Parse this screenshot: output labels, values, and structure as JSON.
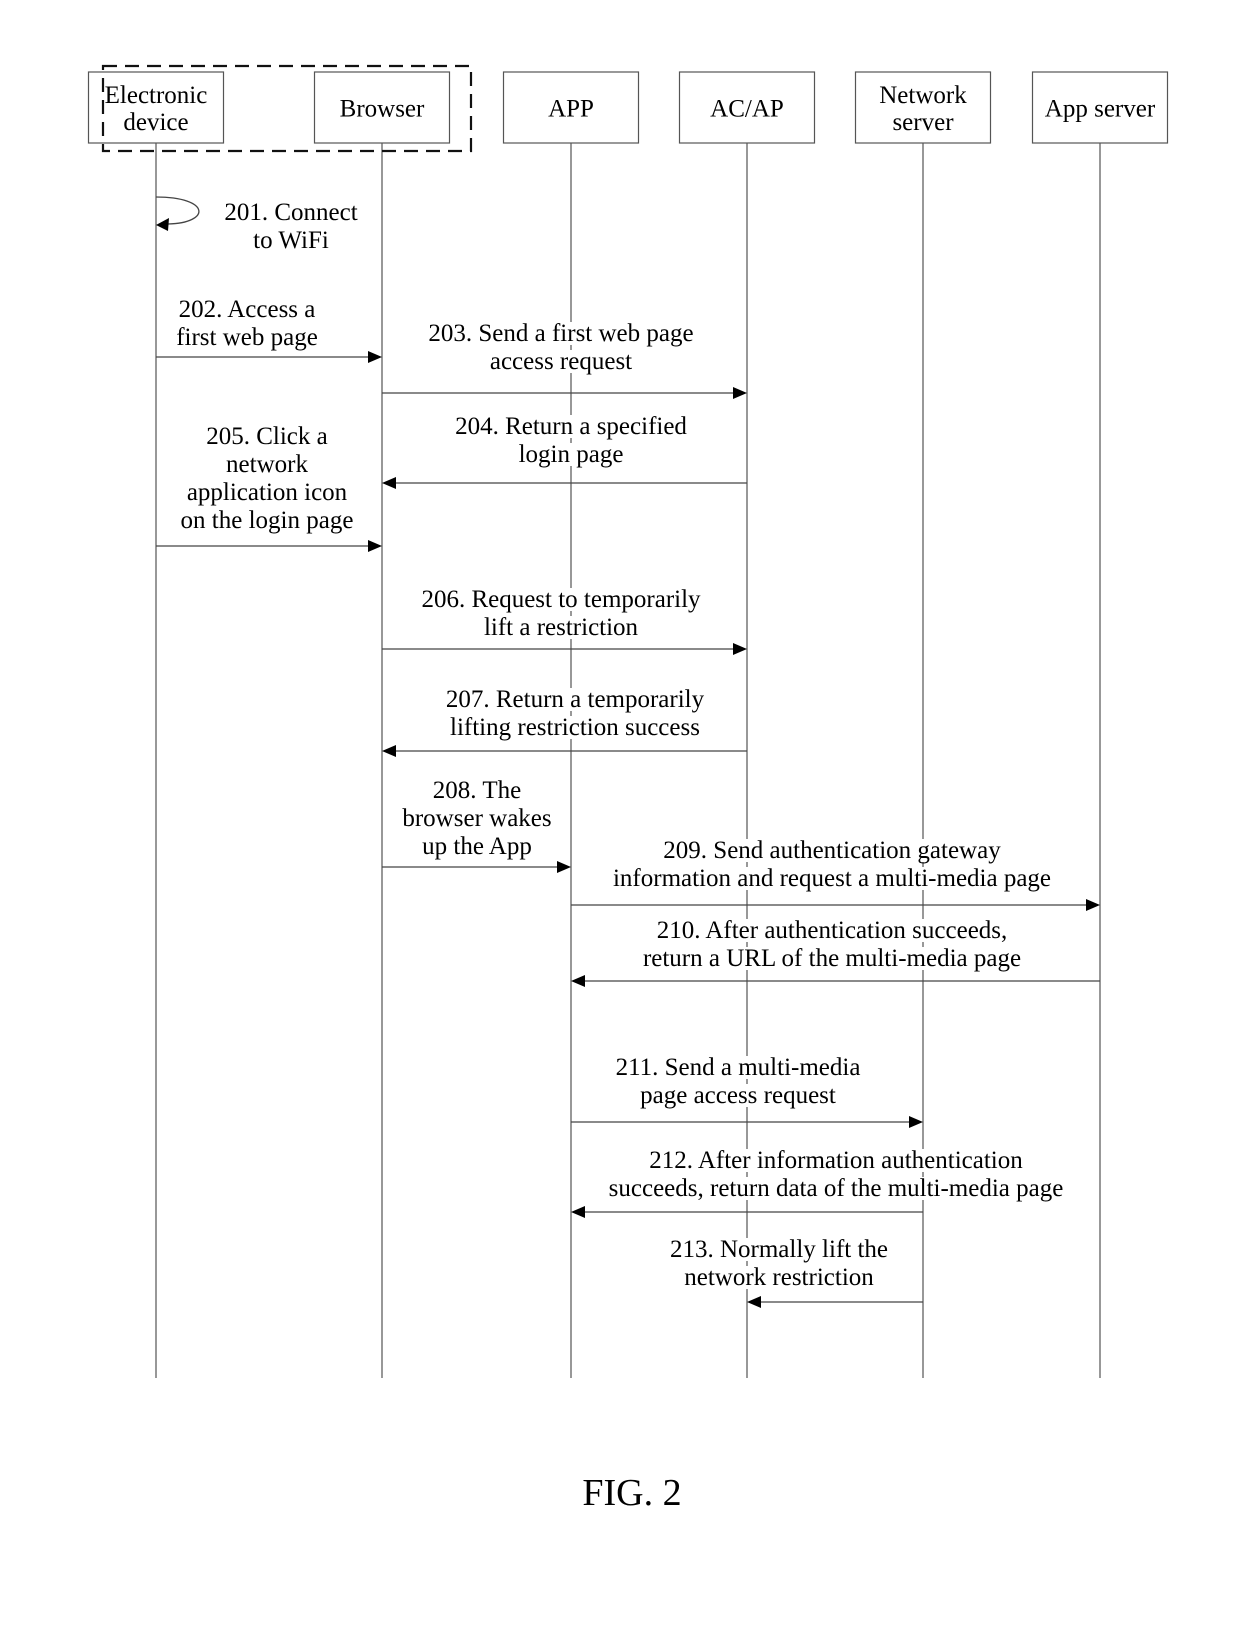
{
  "figure_label": "FIG. 2",
  "group": {
    "name": "terminal",
    "members": [
      "electronic-device",
      "browser"
    ]
  },
  "participants": [
    {
      "id": "electronic-device",
      "lines": [
        "Electronic",
        "device"
      ]
    },
    {
      "id": "browser",
      "lines": [
        "Browser"
      ]
    },
    {
      "id": "app",
      "lines": [
        "APP"
      ]
    },
    {
      "id": "ac-ap",
      "lines": [
        "AC/AP"
      ]
    },
    {
      "id": "network-server",
      "lines": [
        "Network",
        "server"
      ]
    },
    {
      "id": "app-server",
      "lines": [
        "App server"
      ]
    }
  ],
  "messages": [
    {
      "step": "201",
      "from": "electronic-device",
      "to": "electronic-device",
      "self": true,
      "lines": [
        "201. Connect",
        "to WiFi"
      ]
    },
    {
      "step": "202",
      "from": "electronic-device",
      "to": "browser",
      "lines": [
        "202. Access a",
        "first web page"
      ]
    },
    {
      "step": "203",
      "from": "browser",
      "to": "ac-ap",
      "lines": [
        "203. Send a first web page",
        "access request"
      ]
    },
    {
      "step": "204",
      "from": "ac-ap",
      "to": "browser",
      "lines": [
        "204. Return a specified",
        "login page"
      ]
    },
    {
      "step": "205",
      "from": "electronic-device",
      "to": "browser",
      "lines": [
        "205. Click a",
        "network",
        "application icon",
        "on the login page"
      ]
    },
    {
      "step": "206",
      "from": "browser",
      "to": "ac-ap",
      "lines": [
        "206. Request to temporarily",
        "lift a restriction"
      ]
    },
    {
      "step": "207",
      "from": "ac-ap",
      "to": "browser",
      "lines": [
        "207. Return a temporarily",
        "lifting restriction success"
      ]
    },
    {
      "step": "208",
      "from": "browser",
      "to": "app",
      "lines": [
        "208. The",
        "browser wakes",
        "up the App"
      ]
    },
    {
      "step": "209",
      "from": "app",
      "to": "app-server",
      "lines": [
        "209. Send authentication gateway",
        "information and request a multi-media page"
      ]
    },
    {
      "step": "210",
      "from": "app-server",
      "to": "app",
      "lines": [
        "210. After authentication succeeds,",
        "return a URL of the multi-media page"
      ]
    },
    {
      "step": "211",
      "from": "app",
      "to": "network-server",
      "lines": [
        "211. Send a multi-media",
        "page access request"
      ]
    },
    {
      "step": "212",
      "from": "network-server",
      "to": "app",
      "lines": [
        "212. After information authentication",
        "succeeds, return data of the multi-media page"
      ]
    },
    {
      "step": "213",
      "from": "network-server",
      "to": "ac-ap",
      "lines": [
        "213. Normally lift the",
        "network restriction"
      ]
    }
  ]
}
